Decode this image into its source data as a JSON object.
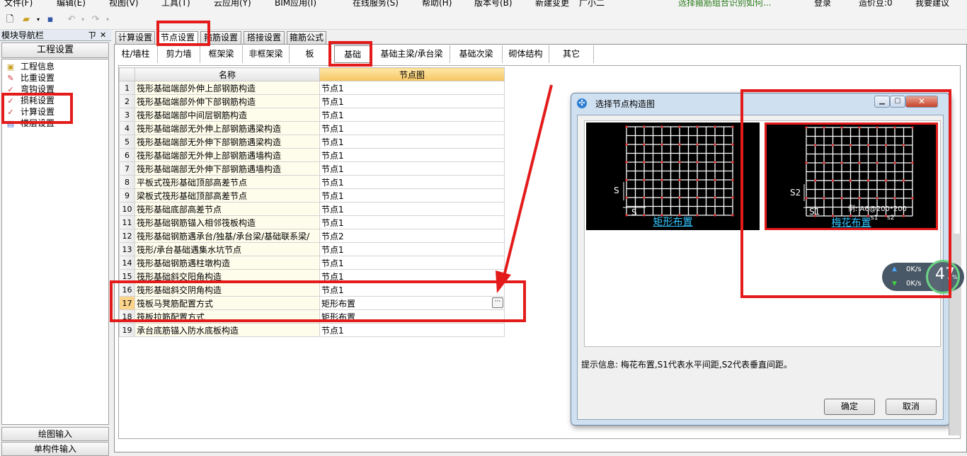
{
  "menubar": [
    "文件(F)",
    "编辑(E)",
    "视图(V)",
    "工具(T)",
    "云应用(Y)",
    "BIM应用(I)",
    "在线服务(S)",
    "帮助(H)",
    "版本号(B)",
    "新建变更",
    "广小二"
  ],
  "menubar_right": {
    "notice": "选择箍筋组合识别如何...",
    "login": "登录",
    "version": "造价豆:0",
    "suggest": "我要建议"
  },
  "nav": {
    "title": "模块导航栏",
    "pin": "ㄗ",
    "close": "✕",
    "header": "工程设置",
    "items": [
      "工程信息",
      "比重设置",
      "弯钩设置",
      "损耗设置",
      "计算设置",
      "楼层设置"
    ],
    "bottom": [
      "绘图输入",
      "单构件输入"
    ]
  },
  "tabs": [
    "计算设置",
    "节点设置",
    "箍筋设置",
    "搭接设置",
    "箍筋公式"
  ],
  "subtabs": [
    "柱/墙柱",
    "剪力墙",
    "框架梁",
    "非框架梁",
    "板",
    "基础",
    "基础主梁/承台梁",
    "基础次梁",
    "砌体结构",
    "其它"
  ],
  "grid": {
    "col_name": "名称",
    "col_node": "节点图",
    "rows": [
      {
        "n": "1",
        "name": "筏形基础端部外伸上部钢筋构造",
        "node": "节点1"
      },
      {
        "n": "2",
        "name": "筏形基础端部外伸下部钢筋构造",
        "node": "节点1"
      },
      {
        "n": "3",
        "name": "筏形基础端部中间层钢筋构造",
        "node": "节点1"
      },
      {
        "n": "4",
        "name": "筏形基础端部无外伸上部钢筋遇梁构造",
        "node": "节点1"
      },
      {
        "n": "5",
        "name": "筏形基础端部无外伸下部钢筋遇梁构造",
        "node": "节点1"
      },
      {
        "n": "6",
        "name": "筏形基础端部无外伸上部钢筋遇墙构造",
        "node": "节点1"
      },
      {
        "n": "7",
        "name": "筏形基础端部无外伸下部钢筋遇墙构造",
        "node": "节点1"
      },
      {
        "n": "8",
        "name": "平板式筏形基础顶部高差节点",
        "node": "节点1"
      },
      {
        "n": "9",
        "name": "梁板式筏形基础顶部高差节点",
        "node": "节点1"
      },
      {
        "n": "10",
        "name": "筏形基础底部高差节点",
        "node": "节点1"
      },
      {
        "n": "11",
        "name": "筏形基础钢筋锚入相邻筏板构造",
        "node": "节点1"
      },
      {
        "n": "12",
        "name": "筏形基础钢筋遇承台/独基/承台梁/基础联系梁/",
        "node": "节点2"
      },
      {
        "n": "13",
        "name": "筏形/承台基础遇集水坑节点",
        "node": "节点1"
      },
      {
        "n": "14",
        "name": "筏形基础钢筋遇柱墩构造",
        "node": "节点1"
      },
      {
        "n": "15",
        "name": "筏形基础斜交阳角构造",
        "node": "节点1"
      },
      {
        "n": "16",
        "name": "筏形基础斜交阴角构造",
        "node": "节点1"
      },
      {
        "n": "17",
        "name": "筏板马凳筋配置方式",
        "node": "矩形布置"
      },
      {
        "n": "18",
        "name": "筏板拉筋配置方式",
        "node": "矩形布置"
      },
      {
        "n": "19",
        "name": "承台底筋锚入防水底板构造",
        "node": "节点1"
      }
    ],
    "ellipsis": "···"
  },
  "dialog": {
    "title": "选择节点构造图",
    "options": [
      {
        "caption": "矩形布置",
        "label_v": "S",
        "label_h": "S"
      },
      {
        "caption": "梅花布置",
        "label_v": "S2",
        "label_h": "S1",
        "example": "例: A6@200*200",
        "ex_s1": "s1",
        "ex_s2": "s2"
      }
    ],
    "hint": "提示信息:  梅花布置,S1代表水平间距,S2代表垂直间距。",
    "ok": "确定",
    "cancel": "取消"
  },
  "speed": {
    "percent": "47",
    "percent_sign": "%",
    "up": "0K/s",
    "down": "0K/s"
  }
}
